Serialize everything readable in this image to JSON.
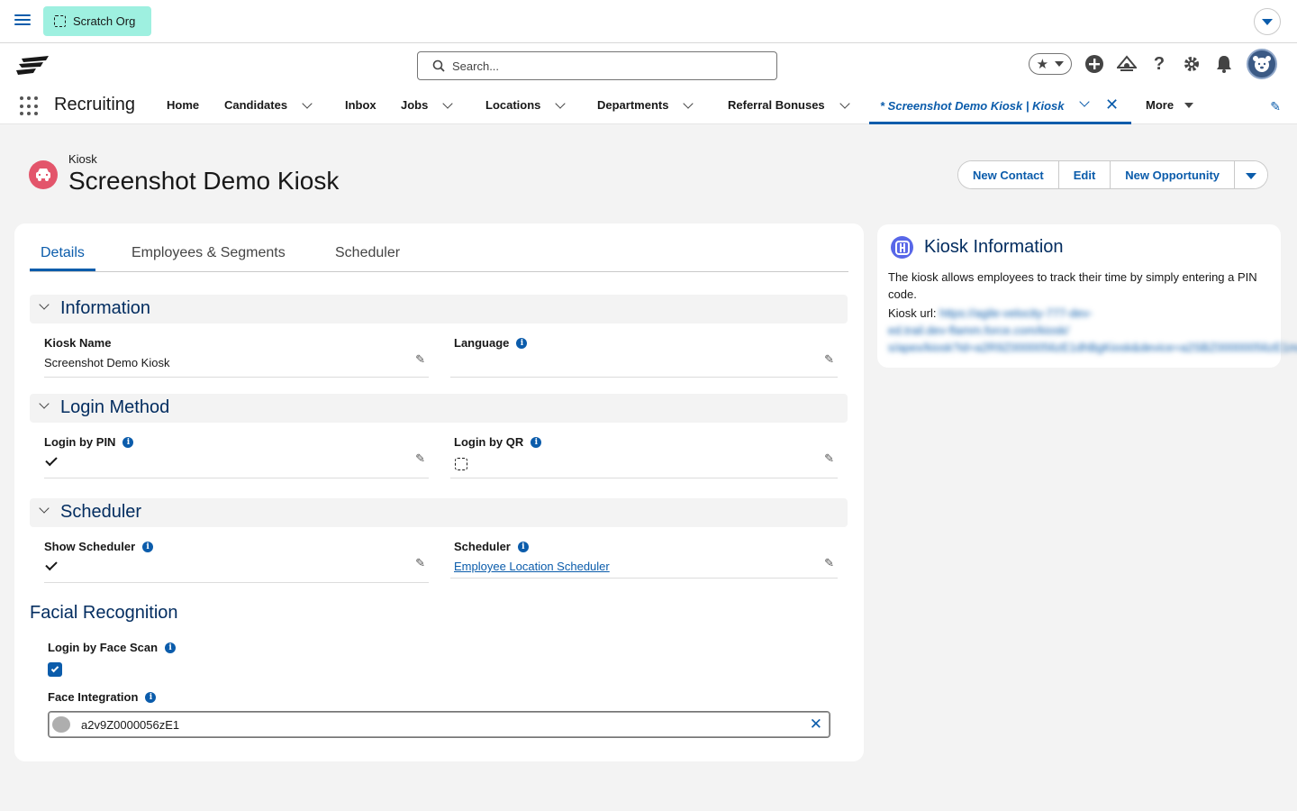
{
  "topbar": {
    "org_label": "Scratch Org"
  },
  "search": {
    "placeholder": "Search..."
  },
  "app": {
    "name": "Recruiting"
  },
  "nav": {
    "items": [
      "Home",
      "Candidates",
      "Inbox",
      "Jobs",
      "Locations",
      "Departments",
      "Referral Bonuses"
    ],
    "active_tab": "* Screenshot Demo Kiosk | Kiosk",
    "more": "More"
  },
  "record": {
    "type": "Kiosk",
    "title": "Screenshot Demo Kiosk",
    "actions": [
      "New Contact",
      "Edit",
      "New Opportunity"
    ]
  },
  "tabs": [
    "Details",
    "Employees & Segments",
    "Scheduler"
  ],
  "sections": {
    "information": "Information",
    "login_method": "Login Method",
    "scheduler": "Scheduler",
    "facial": "Facial Recognition"
  },
  "fields": {
    "kiosk_name": {
      "label": "Kiosk Name",
      "value": "Screenshot Demo Kiosk"
    },
    "language": {
      "label": "Language",
      "value": ""
    },
    "login_by_pin": {
      "label": "Login by PIN",
      "checked": true
    },
    "login_by_qr": {
      "label": "Login by QR",
      "checked": false
    },
    "show_scheduler": {
      "label": "Show Scheduler",
      "checked": true
    },
    "scheduler": {
      "label": "Scheduler",
      "value": "Employee Location Scheduler"
    },
    "login_by_face": {
      "label": "Login by Face Scan",
      "checked": true
    },
    "face_integration": {
      "label": "Face Integration",
      "value": "a2v9Z0000056zE1"
    }
  },
  "side": {
    "title": "Kiosk Information",
    "description": "The kiosk allows employees to track their time by simply entering a PIN code.",
    "url_label": "Kiosk url:",
    "url_line1": "https://agile-velocity-777-dev-",
    "url_line2": "ed.trail.dev-flamm.force.com/kiosk/",
    "url_line3": "s/apex/kiosk?id=a2R9Z0000056zE1dhBgKiosk&device=a2SBZ00000056zE1mask=a2N"
  },
  "colors": {
    "accent": "#0b5cab",
    "heading": "#032d60",
    "scratch": "#9ef0e0",
    "record_icon": "#e3556b"
  }
}
